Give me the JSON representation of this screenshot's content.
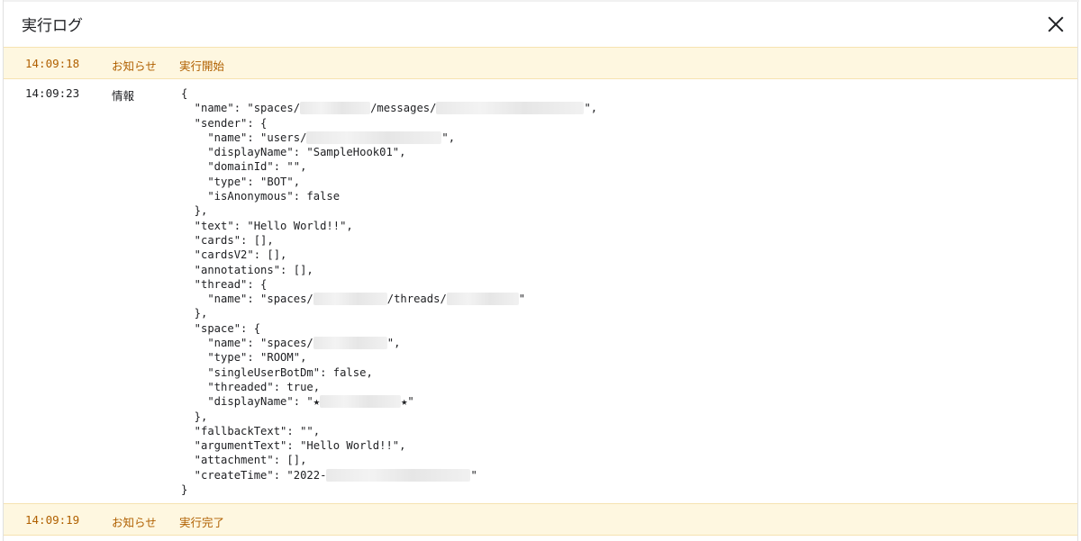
{
  "dialog": {
    "title": "実行ログ",
    "close_icon": "close-icon"
  },
  "colors": {
    "notice_bg": "#fef7e0",
    "notice_text": "#b06000"
  },
  "entries": [
    {
      "time": "14:09:18",
      "level": "お知らせ",
      "message": "実行開始"
    },
    {
      "time": "14:09:23",
      "level": "情報"
    },
    {
      "time": "14:09:19",
      "level": "お知らせ",
      "message": "実行完了"
    }
  ],
  "json_lines": [
    "{",
    "  \"name\": \"spaces/",
    "/messages/",
    "\",",
    "  \"sender\": {",
    "    \"name\": \"users/",
    "\",",
    "    \"displayName\": \"SampleHook01\",",
    "    \"domainId\": \"\",",
    "    \"type\": \"BOT\",",
    "    \"isAnonymous\": false",
    "  },",
    "  \"text\": \"Hello World!!\",",
    "  \"cards\": [],",
    "  \"cardsV2\": [],",
    "  \"annotations\": [],",
    "  \"thread\": {",
    "    \"name\": \"spaces/",
    "/threads/",
    "\"",
    "  },",
    "  \"space\": {",
    "    \"name\": \"spaces/",
    "\",",
    "    \"type\": \"ROOM\",",
    "    \"singleUserBotDm\": false,",
    "    \"threaded\": true,",
    "    \"displayName\": \"★",
    "★\"",
    "  },",
    "  \"fallbackText\": \"\",",
    "  \"argumentText\": \"Hello World!!\",",
    "  \"attachment\": [],",
    "  \"createTime\": \"2022-",
    "\"",
    "}"
  ]
}
